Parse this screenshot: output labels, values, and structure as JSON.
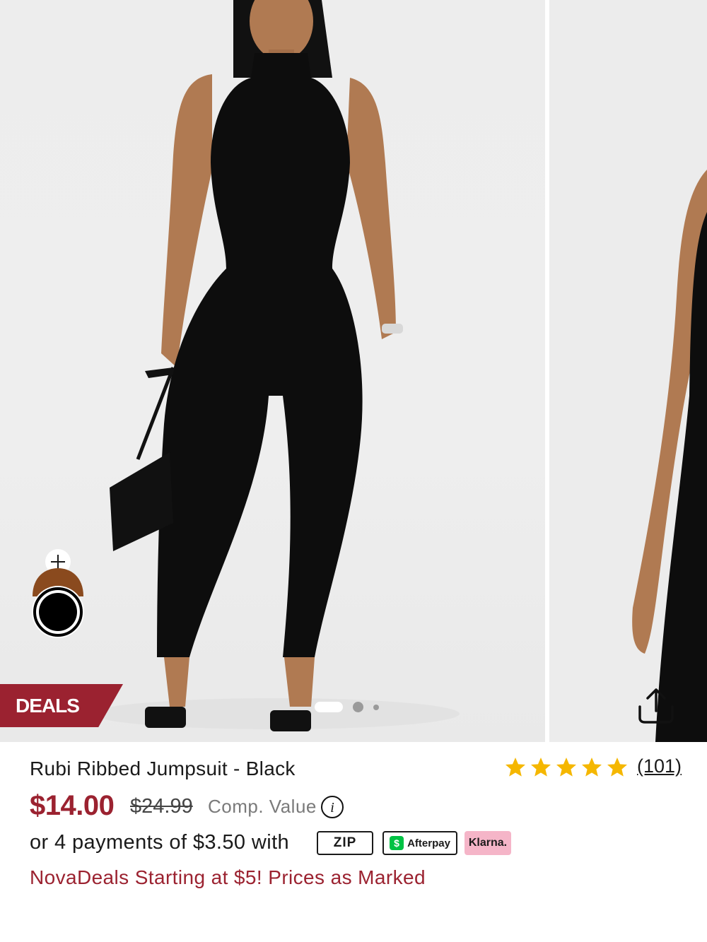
{
  "gallery": {
    "deals_badge": "DEALS",
    "carousel": {
      "total_slides": 3,
      "active_slide": 1
    },
    "icons": {
      "share": "share-upload-icon",
      "swatch_add": "plus-icon"
    }
  },
  "product": {
    "title": "Rubi Ribbed Jumpsuit - Black",
    "rating": {
      "stars": 5,
      "review_count": "(101)"
    },
    "price": "$14.00",
    "original_price": "$24.99",
    "comp_label": "Comp. Value",
    "info_icon_glyph": "i",
    "installments": "or 4 payments of $3.50 with",
    "payment_providers": {
      "zip": "ZIP",
      "afterpay": "Afterpay",
      "afterpay_symbol": "$",
      "klarna": "Klarna."
    },
    "promo": "NovaDeals Starting at $5! Prices as Marked"
  },
  "colors": {
    "accent": "#9b2230",
    "star": "#f5b700",
    "afterpay_green": "#00c244",
    "klarna_pink": "#f5b5c8",
    "swatch_selected": "#000000",
    "swatch_alt": "#8a4a1e"
  }
}
